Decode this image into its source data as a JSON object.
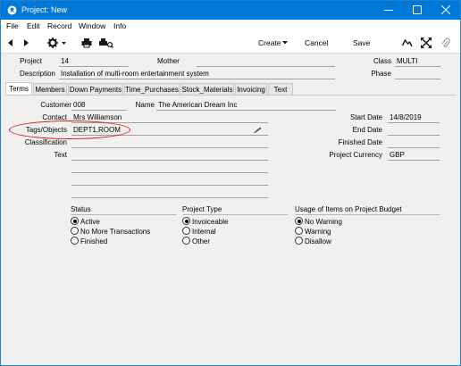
{
  "window": {
    "title": "Project: New"
  },
  "menu": [
    "File",
    "Edit",
    "Record",
    "Window",
    "Info"
  ],
  "toolbar": {
    "create": "Create",
    "cancel": "Cancel",
    "save": "Save"
  },
  "header": {
    "project_label": "Project",
    "project_value": "14",
    "mother_label": "Mother",
    "mother_value": "",
    "class_label": "Class",
    "class_value": "MULTI",
    "description_label": "Description",
    "description_value": "Installation of multi-room entertainment system",
    "phase_label": "Phase",
    "phase_value": ""
  },
  "tabs": [
    "Terms",
    "Members",
    "Down Payments",
    "Time_Purchases",
    "Stock_Materials",
    "Invoicing",
    "Text"
  ],
  "active_tab": "Terms",
  "terms": {
    "customer_label": "Customer",
    "customer_value": "008",
    "name_label": "Name",
    "name_value": "The American Dream Inc",
    "contact_label": "Contact",
    "contact_value": "Mrs Williamson",
    "tags_label": "Tags/Objects",
    "tags_value": "DEPT1,ROOM",
    "classification_label": "Classification",
    "text_label": "Text",
    "start_date_label": "Start Date",
    "start_date_value": "14/8/2019",
    "end_date_label": "End Date",
    "end_date_value": "",
    "finished_date_label": "Finished Date",
    "finished_date_value": "",
    "currency_label": "Project Currency",
    "currency_value": "GBP"
  },
  "status": {
    "title": "Status",
    "options": [
      "Active",
      "No More Transactions",
      "Finished"
    ],
    "selected": "Active"
  },
  "project_type": {
    "title": "Project Type",
    "options": [
      "Invoiceable",
      "Internal",
      "Other"
    ],
    "selected": "Invoiceable"
  },
  "usage": {
    "title": "Usage of Items on Project Budget",
    "options": [
      "No Warning",
      "Warning",
      "Disallow"
    ],
    "selected": "No Warning"
  },
  "colors": {
    "titlebar": "#0078d7",
    "highlight": "#d9141b"
  }
}
